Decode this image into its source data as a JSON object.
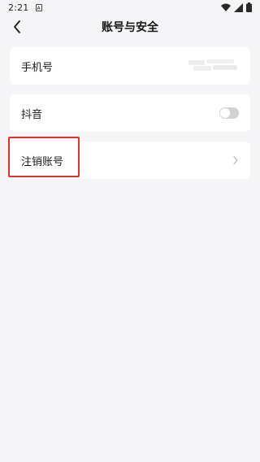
{
  "status_bar": {
    "time": "2:21",
    "notification_badge": "A",
    "icons": [
      "wifi-icon",
      "signal-icon",
      "battery-icon"
    ]
  },
  "header": {
    "title": "账号与安全",
    "back_icon": "chevron-left-icon"
  },
  "settings": {
    "phone": {
      "label": "手机号"
    },
    "douyin": {
      "label": "抖音",
      "toggle_on": false
    },
    "cancel_account": {
      "label": "注销账号",
      "chevron": "chevron-right-icon"
    }
  },
  "colors": {
    "background": "#f5f5f7",
    "card": "#ffffff",
    "highlight": "#e0342a",
    "toggle_off": "#d2d2d4"
  }
}
